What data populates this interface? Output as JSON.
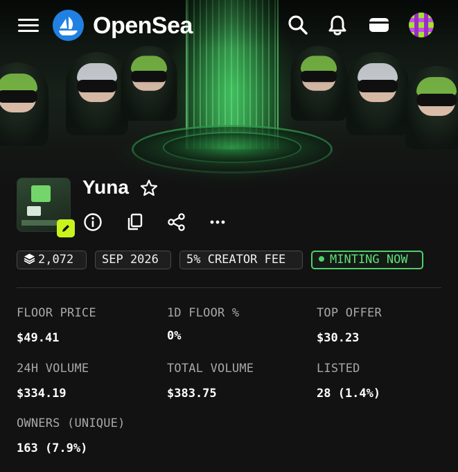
{
  "nav": {
    "brand": "OpenSea",
    "icons": [
      "menu-icon",
      "opensea-logo-icon",
      "search-icon",
      "bell-icon",
      "wallet-icon",
      "avatar"
    ]
  },
  "collection": {
    "name": "Yuna",
    "action_icons": [
      "info-icon",
      "copy-icon",
      "share-icon",
      "more-icon"
    ]
  },
  "tags": {
    "items_count": "2,072",
    "date": "SEP 2026",
    "creator_fee": "5% CREATOR FEE",
    "status": "MINTING NOW"
  },
  "stats": [
    {
      "label": "FLOOR PRICE",
      "value": "$49.41"
    },
    {
      "label": "1D FLOOR %",
      "value": "0%"
    },
    {
      "label": "TOP OFFER",
      "value": "$30.23"
    },
    {
      "label": "24H VOLUME",
      "value": "$334.19"
    },
    {
      "label": "TOTAL VOLUME",
      "value": "$383.75"
    },
    {
      "label": "LISTED",
      "value": "28 (1.4%)"
    },
    {
      "label": "OWNERS (UNIQUE)",
      "value": "163 (7.9%)"
    }
  ],
  "colors": {
    "background": "#121212",
    "brand_blue": "#2081e2",
    "edit_badge": "#c9f31d",
    "minting_green": "#4fd06a"
  }
}
